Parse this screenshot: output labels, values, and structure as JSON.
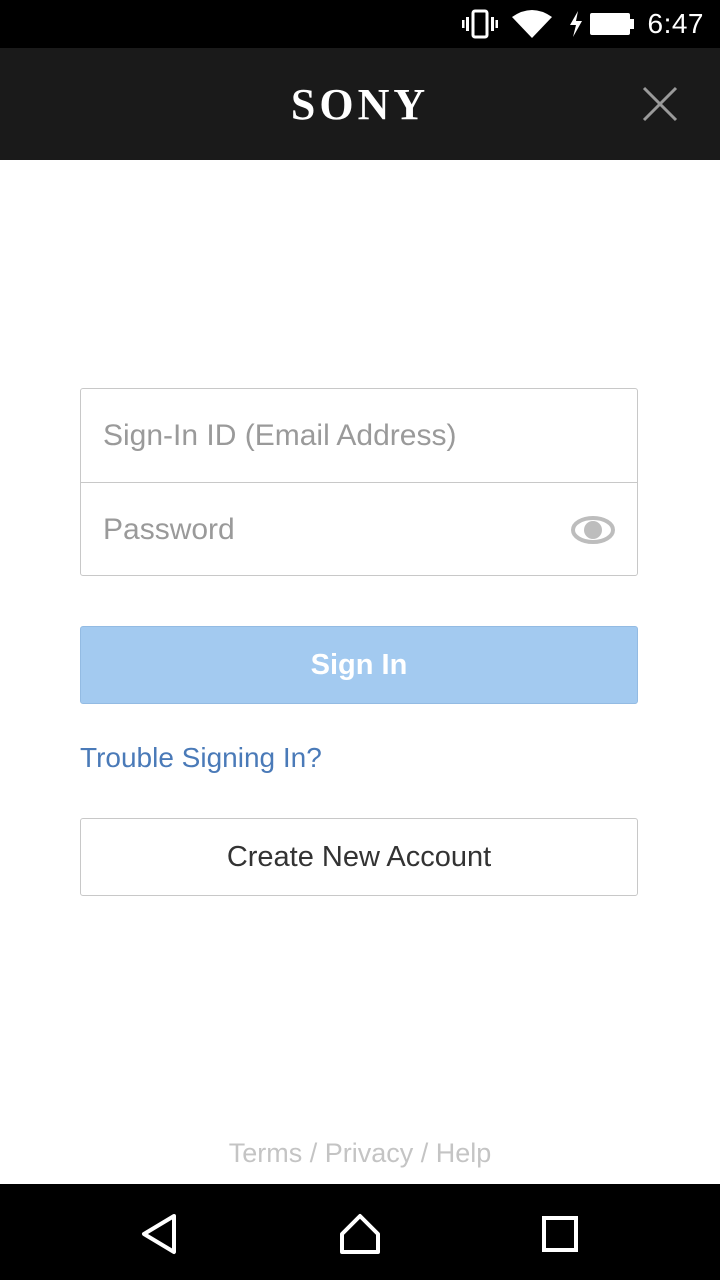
{
  "status_bar": {
    "time": "6:47",
    "icons": [
      "vibrate-icon",
      "wifi-icon",
      "battery-charging-icon"
    ]
  },
  "app_bar": {
    "brand": "SONY",
    "close_icon": "close-icon"
  },
  "form": {
    "email_placeholder": "Sign-In ID (Email Address)",
    "email_value": "",
    "password_placeholder": "Password",
    "password_value": "",
    "password_toggle_icon": "eye-icon"
  },
  "actions": {
    "sign_in_label": "Sign In",
    "trouble_label": "Trouble Signing In?",
    "create_account_label": "Create New Account"
  },
  "footer": {
    "terms": "Terms",
    "privacy": "Privacy",
    "help": "Help",
    "separator": " / "
  },
  "colors": {
    "sign_in_button": "#a3caf0",
    "link": "#4a7ab8",
    "app_bar": "#1a1a1a"
  },
  "nav_bar": {
    "icons": [
      "back-icon",
      "home-icon",
      "recents-icon"
    ]
  }
}
